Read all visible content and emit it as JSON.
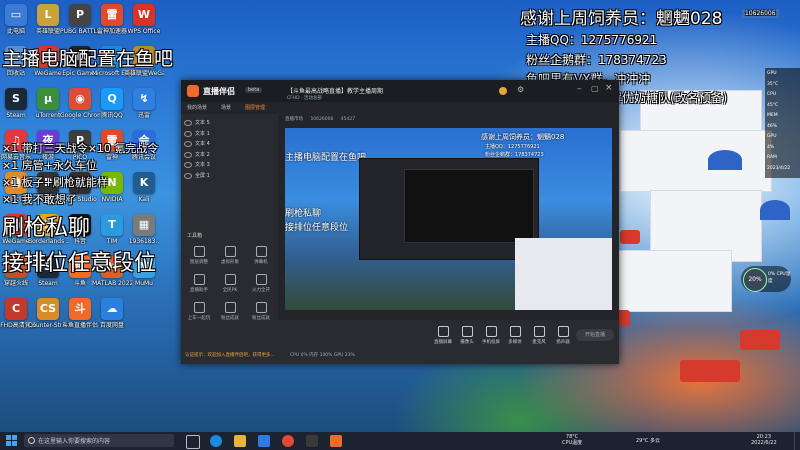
{
  "overlay": {
    "thanks": "感谢上周饲养员：魍魉028",
    "qq": "主播QQ：1275776921",
    "fan_group": "粉丝企鹅群：178374723",
    "vx": "鱼吧里有VX群，冲冲冲",
    "team": "战队名称搜索：解优奶糖队(改名预备)",
    "config": "主播电脑配置在鱼吧",
    "perks": [
      "×1 带打三天战令×10 氪完战令",
      "×1 房管+永久车位",
      "×1 板子+刷枪就能样",
      "×1 我不敢想了"
    ],
    "private": "刷枪私聊",
    "rank": "接排位任意段位",
    "badge": "10626006"
  },
  "desktop_icons": [
    {
      "label": "此电脑",
      "glyph": "▭",
      "color": "#3a7bd5"
    },
    {
      "label": "英雄联盟",
      "glyph": "L",
      "color": "#c9a23a"
    },
    {
      "label": "PUBG BATTLEGR..",
      "glyph": "P",
      "color": "#444"
    },
    {
      "label": "雷神加速器",
      "glyph": "雷",
      "color": "#e04a2a"
    },
    {
      "label": "WPS Office",
      "glyph": "W",
      "color": "#d9322b"
    },
    {
      "label": "回收站",
      "glyph": "♻",
      "color": "#5a8fd5"
    },
    {
      "label": "WeGame",
      "glyph": "W",
      "color": "#cc3b2f"
    },
    {
      "label": "Epic Games",
      "glyph": "E",
      "color": "#222"
    },
    {
      "label": "Microsoft Edge",
      "glyph": "e",
      "color": "#1b8ad8"
    },
    {
      "label": "英雄联盟WeGame版",
      "glyph": "L",
      "color": "#b88b2a"
    },
    {
      "label": "Steam",
      "glyph": "S",
      "color": "#1b2838"
    },
    {
      "label": "uTorrent",
      "glyph": "µ",
      "color": "#3b8e3b"
    },
    {
      "label": "Google Chrome",
      "glyph": "◉",
      "color": "#dd4b39"
    },
    {
      "label": "腾讯QQ",
      "glyph": "Q",
      "color": "#1a9af7"
    },
    {
      "label": "迅雷",
      "glyph": "↯",
      "color": "#2d7fe0"
    },
    {
      "label": "网易云音乐",
      "glyph": "♫",
      "color": "#e03a3a"
    },
    {
      "label": "夜游",
      "glyph": "夜",
      "color": "#6a3bd8"
    },
    {
      "label": "PICO",
      "glyph": "P",
      "color": "#3e3e3e"
    },
    {
      "label": "雷神",
      "glyph": "雷",
      "color": "#e04a2a"
    },
    {
      "label": "腾讯会议",
      "glyph": "会",
      "color": "#2a6be0"
    },
    {
      "label": "鲁大师",
      "glyph": "鲁",
      "color": "#e08a2a"
    },
    {
      "label": "PREY",
      "glyph": "P",
      "color": "#333"
    },
    {
      "label": "OBS Studio",
      "glyph": "●",
      "color": "#302e31"
    },
    {
      "label": "NVIDIA",
      "glyph": "N",
      "color": "#76b900"
    },
    {
      "label": "Kali",
      "glyph": "K",
      "color": "#215b8f"
    },
    {
      "label": "WeGame",
      "glyph": "W",
      "color": "#cc3b2f"
    },
    {
      "label": "Borderlands 3",
      "glyph": "3",
      "color": "#e0a82a"
    },
    {
      "label": "抖音",
      "glyph": "♪",
      "color": "#111"
    },
    {
      "label": "TIM",
      "glyph": "T",
      "color": "#2a9be0"
    },
    {
      "label": "1936183..",
      "glyph": "▦",
      "color": "#7a7a7a"
    },
    {
      "label": "穿越火线",
      "glyph": "C",
      "color": "#c4502a"
    },
    {
      "label": "Steam",
      "glyph": "S",
      "color": "#1b2838"
    },
    {
      "label": "斗鱼",
      "glyph": "鱼",
      "color": "#f06a2a"
    },
    {
      "label": "MATLAB 2022a",
      "glyph": "M",
      "color": "#d9622b"
    },
    {
      "label": "MuMu",
      "glyph": "M",
      "color": "#3aa0e0"
    },
    {
      "label": "CFHD高清竞技大厅",
      "glyph": "C",
      "color": "#c43a2a"
    },
    {
      "label": "Counter-Strike Global Of..",
      "glyph": "CS",
      "color": "#d98b2a"
    },
    {
      "label": "斗鱼直播伴侣",
      "glyph": "斗",
      "color": "#f06a2a"
    },
    {
      "label": "百度网盘",
      "glyph": "☁",
      "color": "#2a7fe0"
    }
  ],
  "app": {
    "logo": "直播伴侣",
    "version": "beta",
    "left_tabs": [
      "我的场景",
      "场景",
      "图层管理"
    ],
    "layers": [
      "文本 5",
      "文本 1",
      "文本 4",
      "文本 2",
      "文本 3",
      "全屏 1"
    ],
    "tools_title": "工具箱",
    "tools": [
      "图层调整",
      "虚拟形象",
      "弹幕机",
      "直播助手",
      "全民PK",
      "火力全开",
      "上车一起玩",
      "粉丝成就",
      "粉丝成就"
    ],
    "stage_title": "【斗鱼最高战略直播】教学主播周期",
    "stage_tag": "CFHD · 活动总部",
    "stage_meta1": "直播市场",
    "stage_meta2": "10626006",
    "stage_meta3": "45427",
    "bottom_buttons": [
      "直播屏幕",
      "摄像头",
      "手机投屏",
      "多媒体",
      "麦克风",
      "扬声器"
    ],
    "bottom_status": "CPU 0%  内存 100%  GPU 23%",
    "start_label": "开始直播",
    "bottom_notice": "认证提示：欢迎加入直播伴侣吧，获得更多..."
  },
  "right_monitor": [
    "GPU",
    "35°C",
    "CPU",
    "45°C",
    "MEM",
    "46%",
    "GPU",
    "4%",
    "RAM",
    "2023/4/22"
  ],
  "gauge": {
    "value": "20%",
    "label": "0% CPU温度"
  },
  "taskbar": {
    "search_placeholder": "在这里输入你要搜索的内容",
    "cpu": "78°C",
    "cpu_label": "CPU温度",
    "weather": "29°C 多云",
    "time": "20:23",
    "date": "2022/6/22"
  }
}
